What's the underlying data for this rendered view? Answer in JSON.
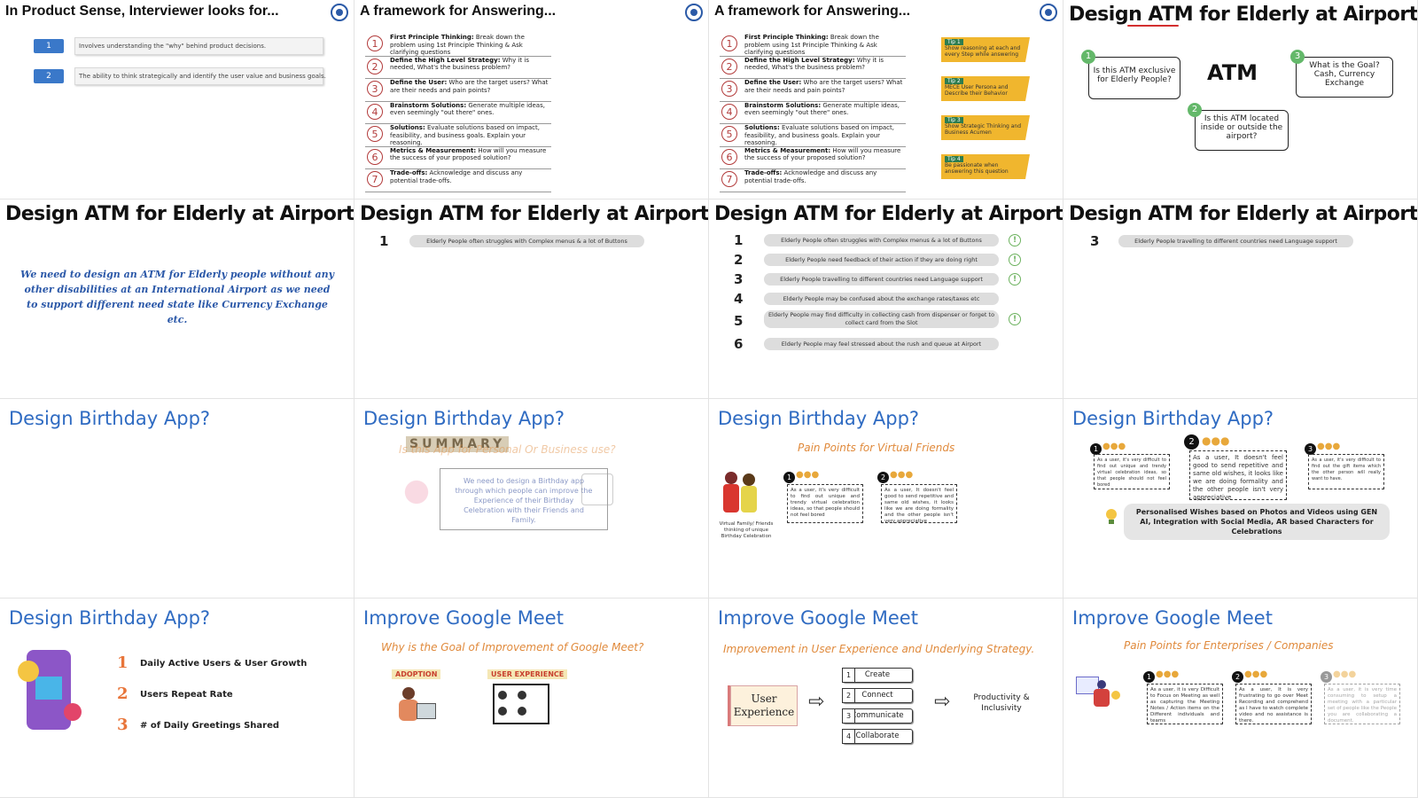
{
  "slides": {
    "s1": {
      "title": "In Product Sense, Interviewer looks for...",
      "rows": [
        {
          "num": "1",
          "text": "Involves understanding the \"why\" behind product decisions."
        },
        {
          "num": "2",
          "text": "The ability to think strategically and identify the user value and business goals."
        }
      ]
    },
    "s2": {
      "title": "A framework for Answering...",
      "items": [
        {
          "num": "1",
          "head": "First Principle Thinking:",
          "body": "Break down the problem using 1st Principle Thinking & Ask clarifying questions"
        },
        {
          "num": "2",
          "head": "Define the High Level Strategy:",
          "body": "Why it is needed, What's the business problem?"
        },
        {
          "num": "3",
          "head": "Define the User:",
          "body": "Who are the target users? What are their needs and pain points?"
        },
        {
          "num": "4",
          "head": "Brainstorm Solutions:",
          "body": "Generate multiple ideas, even seemingly \"out there\" ones."
        },
        {
          "num": "5",
          "head": "Solutions:",
          "body": "Evaluate solutions based on impact, feasibility, and business goals. Explain your reasoning."
        },
        {
          "num": "6",
          "head": "Metrics & Measurement:",
          "body": "How will you measure the success of your proposed solution?"
        },
        {
          "num": "7",
          "head": "Trade-offs:",
          "body": "Acknowledge and discuss any potential trade-offs."
        }
      ]
    },
    "s3": {
      "title": "A framework for Answering...",
      "tips": [
        {
          "label": "Tip 1",
          "text": "Show reasoning at each and every Step while answering"
        },
        {
          "label": "Tip 2",
          "text": "MECE User Persona and Describe their Behavior"
        },
        {
          "label": "Tip 3",
          "text": "Show Strategic Thinking and Business Acumen"
        },
        {
          "label": "Tip 4",
          "text": "Be passionate when answering this question"
        }
      ]
    },
    "s4": {
      "title": "Design ATM for Elderly at Airport?",
      "center": "ATM",
      "questions": [
        {
          "num": "1",
          "text": "Is this ATM exclusive for Elderly People?"
        },
        {
          "num": "2",
          "text": "Is this ATM located inside or outside the airport?"
        },
        {
          "num": "3",
          "text": "What is the Goal? Cash, Currency Exchange"
        }
      ]
    },
    "s5": {
      "title": "Design ATM for Elderly at Airport?",
      "statement": "We need to design an ATM for Elderly people without any other disabilities at an International Airport as we need to support different need state like Currency Exchange etc."
    },
    "s6": {
      "title": "Design ATM for Elderly at Airport?",
      "items": [
        {
          "num": "1",
          "text": "Elderly People often struggles with Complex menus & a lot of Buttons"
        }
      ]
    },
    "s7": {
      "title": "Design ATM for Elderly at Airport?",
      "items": [
        {
          "num": "1",
          "text": "Elderly People often struggles with Complex menus & a lot of Buttons",
          "mark": "!"
        },
        {
          "num": "2",
          "text": "Elderly People need feedback of their action if they are doing right",
          "mark": "!"
        },
        {
          "num": "3",
          "text": "Elderly People travelling to different countries need Language support",
          "mark": "!"
        },
        {
          "num": "4",
          "text": "Elderly People may be confused about the exchange rates/taxes etc",
          "mark": ""
        },
        {
          "num": "5",
          "text": "Elderly People may find difficulty in collecting cash from dispenser or forget to collect card from the Slot",
          "mark": "!"
        },
        {
          "num": "6",
          "text": "Elderly People may feel stressed about the rush and queue at Airport",
          "mark": ""
        }
      ]
    },
    "s8": {
      "title": "Design ATM for Elderly at Airport?",
      "items": [
        {
          "num": "3",
          "text": "Elderly People travelling to different countries need Language support"
        }
      ]
    },
    "s9": {
      "title": "Design Birthday App?"
    },
    "s10": {
      "title": "Design Birthday App?",
      "summary": "SUMMARY",
      "question": "Is this App for Personal Or Business use?",
      "body": "We need to design a Birthday app through which people can improve the Experience of their Birthday Celebration with their Friends and Family."
    },
    "s11": {
      "title": "Design Birthday App?",
      "subtitle": "Pain Points for Virtual Friends",
      "caption": "Virtual Family/ Friends thinking of unique Birthday Celebration",
      "cards": [
        {
          "num": "1",
          "text": "As a user, it's very difficult to find out unique and trendy virtual celebration ideas, so that people should not feel bored"
        },
        {
          "num": "2",
          "text": "As a user, It doesn't feel good to send repetitive and same old wishes, it looks like we are doing formality and the other people isn't very appreciative"
        }
      ]
    },
    "s12": {
      "title": "Design Birthday App?",
      "cards": [
        {
          "num": "1",
          "text": "As a user, it's very difficult to find out unique and trendy virtual celebration ideas, so that people should not feel bored"
        },
        {
          "num": "2",
          "text": "As a user, It doesn't feel good to send repetitive and same old wishes, it looks like we are doing formality and the other people isn't very appreciative"
        },
        {
          "num": "3",
          "text": "As a user, it's very difficult to find out the gift items which the other person will really want to have."
        }
      ],
      "solution": "Personalised Wishes based on Photos and Videos using GEN AI, Integration with Social Media, AR based Characters for Celebrations"
    },
    "s13": {
      "title": "Design Birthday App?",
      "metrics": [
        {
          "num": "1",
          "text": "Daily Active Users & User Growth"
        },
        {
          "num": "2",
          "text": "Users Repeat Rate"
        },
        {
          "num": "3",
          "text": "# of Daily Greetings Shared"
        }
      ]
    },
    "s14": {
      "title": "Improve Google Meet",
      "subtitle": "Why is the Goal of Improvement of Google Meet?",
      "labels": [
        "ADOPTION",
        "USER EXPERIENCE"
      ]
    },
    "s15": {
      "title": "Improve Google Meet",
      "subtitle": "Improvement in User Experience and Underlying Strategy.",
      "left": "User Experience",
      "steps": [
        {
          "num": "1",
          "text": "Create"
        },
        {
          "num": "2",
          "text": "Connect"
        },
        {
          "num": "3",
          "text": "Communicate"
        },
        {
          "num": "4",
          "text": "Collaborate"
        }
      ],
      "right": "Productivity & Inclusivity"
    },
    "s16": {
      "title": "Improve Google Meet",
      "subtitle": "Pain Points for Enterprises / Companies",
      "cards": [
        {
          "num": "1",
          "text": "As a user, it is very Difficult to Focus on Meeting as well as capturing the Meeting Notes / Action items on the Different individuals and teams"
        },
        {
          "num": "2",
          "text": "As a user, It is very frustrating to go over Meet Recording and comprehend as I have to watch complete video and no assistance is there."
        },
        {
          "num": "3",
          "text": "As a user, it is very time consuming to setup a meeting with a particular set of people like the People you are collaborating a document."
        }
      ]
    }
  }
}
